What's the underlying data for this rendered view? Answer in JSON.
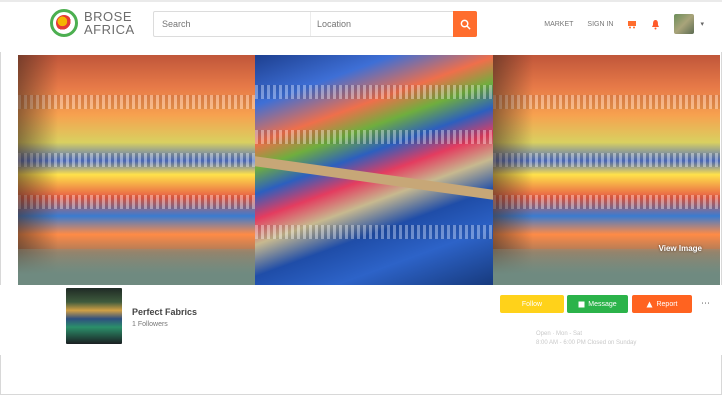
{
  "brand": {
    "line1": "BROSE",
    "line2": "AFRICA"
  },
  "search": {
    "placeholder": "Search",
    "location_placeholder": "Location",
    "button_icon": "search-icon"
  },
  "nav": {
    "link1": "MARKET",
    "link2": "SIGN IN",
    "cart_icon": "cart-icon",
    "bell_icon": "bell-icon"
  },
  "gallery": {
    "view_label": "View Image"
  },
  "business": {
    "name": "Perfect Fabrics",
    "subtitle": "1 Followers"
  },
  "actions": {
    "follow": "Follow",
    "message": "Message",
    "report": "Report",
    "more": "⋯"
  },
  "hours": {
    "line1": "Open · Mon - Sat",
    "line2": "8:00 AM - 6:00 PM   Closed on Sunday"
  },
  "colors": {
    "accent": "#ff6d2d",
    "green": "#2bb34a",
    "yellow": "#ffd21a",
    "orange": "#ff6320"
  }
}
